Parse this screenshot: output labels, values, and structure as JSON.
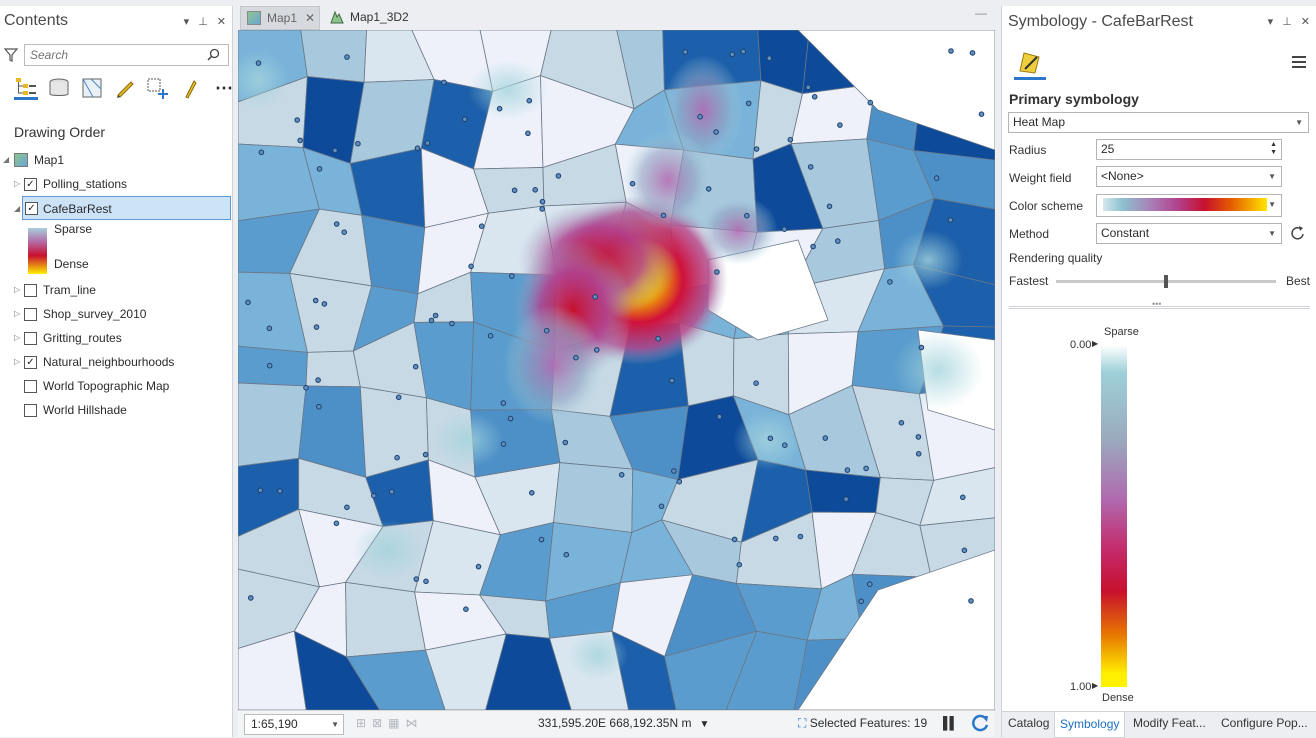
{
  "contents": {
    "title": "Contents",
    "search_placeholder": "Search",
    "drawing_order": "Drawing Order",
    "map_name": "Map1",
    "layers": [
      {
        "label": "Polling_stations",
        "checked": true
      },
      {
        "label": "CafeBarRest",
        "checked": true
      },
      {
        "label": "Tram_line",
        "checked": false
      },
      {
        "label": "Shop_survey_2010",
        "checked": false
      },
      {
        "label": "Gritting_routes",
        "checked": false
      },
      {
        "label": "Natural_neighbourhoods",
        "checked": true
      },
      {
        "label": "World Topographic Map",
        "checked": false
      },
      {
        "label": "World Hillshade",
        "checked": false
      }
    ],
    "legend": {
      "sparse": "Sparse",
      "dense": "Dense"
    },
    "icons": [
      "filter-icon",
      "search-icon",
      "list-by-drawing-order-icon",
      "list-by-source-icon",
      "list-by-selection-icon",
      "list-by-editing-icon",
      "list-by-snapping-icon",
      "list-by-labeling-icon",
      "more-icon"
    ]
  },
  "map_view": {
    "tabs": [
      {
        "label": "Map1",
        "active": false
      },
      {
        "label": "Map1_3D2",
        "active": true
      }
    ],
    "scale": "1:65,190",
    "coordinates": "331,595.20E 668,192.35N m",
    "selected_features": "Selected Features: 19",
    "colors": {
      "boundary": "#6a7787",
      "light": "#c6d9e5",
      "mid": "#5a9ccd",
      "dark": "#1c5faa",
      "darkest": "#0d4a99",
      "point": "#1e3f6b"
    }
  },
  "symbology": {
    "title": "Symbology - CafeBarRest",
    "primary_label": "Primary symbology",
    "primary_value": "Heat Map",
    "radius_label": "Radius",
    "radius_value": "25",
    "weight_label": "Weight field",
    "weight_value": "<None>",
    "color_scheme_label": "Color scheme",
    "method_label": "Method",
    "method_value": "Constant",
    "rendering_label": "Rendering quality",
    "fastest": "Fastest",
    "best": "Best",
    "rendering_quality": 0.5,
    "ramp_top_label": "Sparse",
    "ramp_top_value": "0.00",
    "ramp_bottom_value": "1.00",
    "ramp_bottom_label": "Dense"
  },
  "bottom_tabs": [
    "Catalog",
    "Symbology",
    "Modify Feat...",
    "Configure Pop..."
  ]
}
